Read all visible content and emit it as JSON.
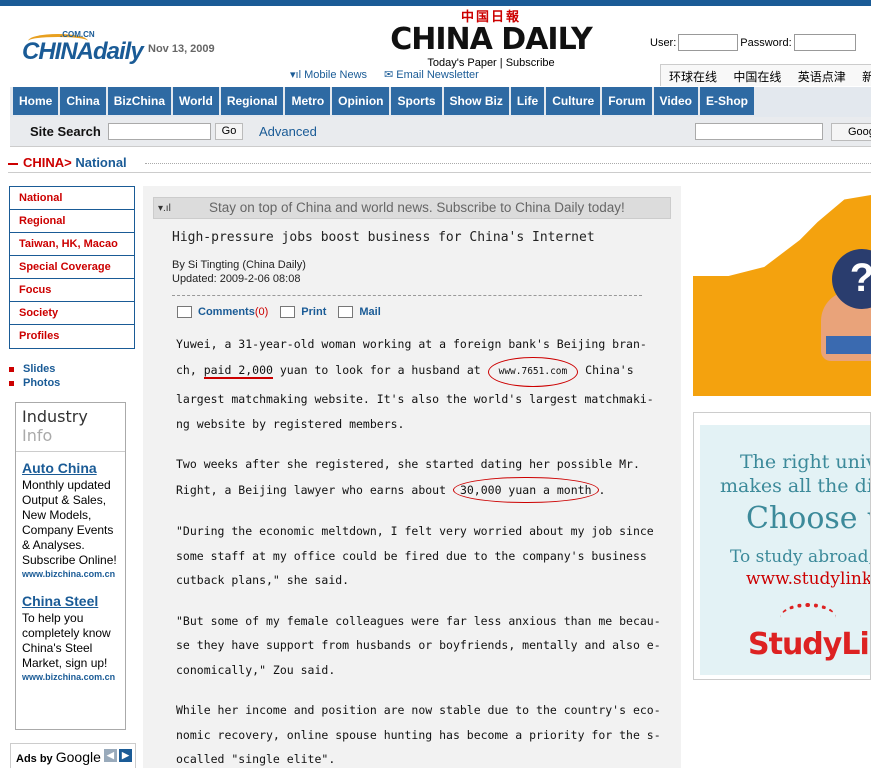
{
  "header": {
    "date": "Nov 13, 2009",
    "logo_small": ".COM.CN",
    "logo_text": "CHINAdaily",
    "masthead_cn": "中国日報",
    "masthead_en": "CHINA DAILY",
    "todays_paper": "Today's Paper",
    "separator": "|",
    "subscribe": "Subscribe",
    "user_label": "User:",
    "password_label": "Password:",
    "mobile_news": "Mobile News",
    "email_newsletter": "Email Newsletter",
    "cn_links": [
      "环球在线",
      "中国在线",
      "英语点津",
      "新闻"
    ]
  },
  "nav": {
    "items": [
      "Home",
      "China",
      "BizChina",
      "World",
      "Regional",
      "Metro",
      "Opinion",
      "Sports",
      "Show Biz",
      "Life",
      "Culture",
      "Forum",
      "Video",
      "E-Shop"
    ]
  },
  "search": {
    "label": "Site Search",
    "go": "Go",
    "advanced": "Advanced",
    "google_btn": "Goog"
  },
  "breadcrumb": {
    "root": "CHINA",
    "sep": ">",
    "current": " National"
  },
  "leftnav": {
    "items": [
      "National",
      "Regional",
      "Taiwan, HK, Macao",
      "Special Coverage",
      "Focus",
      "Society",
      "Profiles"
    ]
  },
  "media_links": [
    "Slides",
    "Photos"
  ],
  "industry": {
    "title_a": "Industry ",
    "title_b": "Info",
    "blocks": [
      {
        "title": "Auto China",
        "desc": "Monthly updated Output & Sales, New Models, Company Events & Analyses. Subscribe Online!",
        "url": "www.bizchina.com.cn"
      },
      {
        "title": "China Steel",
        "desc": "To help you completely know China's Steel Market, sign up!",
        "url": "www.bizchina.com.cn"
      }
    ]
  },
  "ads_by": "Ads by",
  "ads_google": "Google",
  "article": {
    "subscribe_bar": "Stay on top of China and world news. Subscribe to China Daily today!",
    "headline": "High-pressure jobs boost business for China's Internet",
    "byline": "By Si Tingting (China Daily)",
    "updated": "Updated: 2009-2-06 08:08",
    "comments_label": "Comments",
    "comments_count": "(0)",
    "print": "Print",
    "mail": "Mail",
    "p1_a": "Yuwei, a 31-year-old woman working at a foreign bank's Beijing bran-ch, ",
    "p1_hl": "paid 2,000",
    "p1_b": " yuan to look for a husband at ",
    "p1_url": "www.7651.com",
    "p1_c": " China's largest matchmaking website. It's also the world's largest matchmaki-ng website by registered members.",
    "p2_a": "Two weeks after she registered, she started dating her possible Mr. Right, a Beijing lawyer who earns about ",
    "p2_hl": "30,000 yuan a month",
    "p2_b": ".",
    "p3": "\"During the economic meltdown, I felt very worried about my job since some staff at my office could be fired due to the company's business cutback plans,\" she said.",
    "p4": "\"But some of my female colleagues were far less anxious than me becau-se they have support from husbands or boyfriends, mentally and also e-conomically,\" Zou said.",
    "p5": "While her income and position are now stable due to the country's eco-nomic recovery, online spouse hunting has become a priority for the s-ocalled \"single elite\"."
  },
  "ads": {
    "ad1_symbol": "?",
    "studylink": {
      "line1": "The right unive",
      "line2": "makes all the diff",
      "line3": "Choose w",
      "line4": "To study abroad, s",
      "line5": "www.studylink.",
      "logo": "StudyLin"
    }
  },
  "colors": {
    "brand_blue": "#1a5b96",
    "nav_blue": "#2e6aa3",
    "accent_red": "#cc0000"
  }
}
